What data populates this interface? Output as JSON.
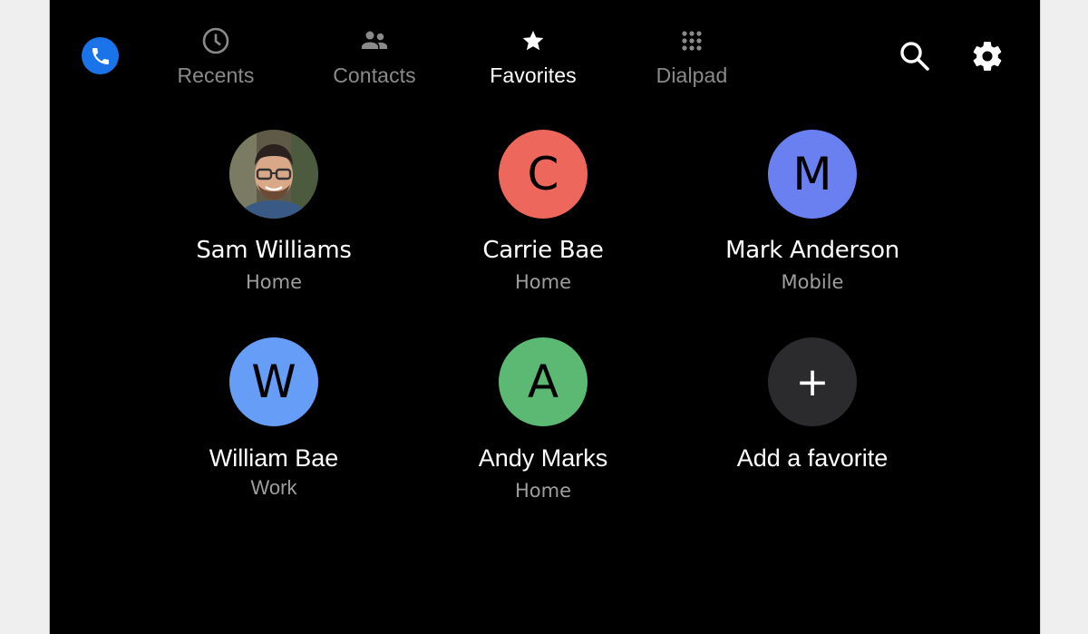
{
  "app": {
    "name": "Phone",
    "icon": "phone-icon",
    "accent_color": "#1a73e8"
  },
  "tabs": [
    {
      "label": "Recents",
      "icon": "clock-icon",
      "active": false
    },
    {
      "label": "Contacts",
      "icon": "people-icon",
      "active": false
    },
    {
      "label": "Favorites",
      "icon": "star-icon",
      "active": true
    },
    {
      "label": "Dialpad",
      "icon": "dialpad-icon",
      "active": false
    }
  ],
  "actions": {
    "search": {
      "icon": "search-icon",
      "label": "Search"
    },
    "settings": {
      "icon": "gear-icon",
      "label": "Settings"
    }
  },
  "favorites": [
    {
      "name": "Sam Williams",
      "type": "Home",
      "avatar": "photo",
      "initial": "",
      "color": ""
    },
    {
      "name": "Carrie Bae",
      "type": "Home",
      "avatar": "initial",
      "initial": "C",
      "color": "#ee675c"
    },
    {
      "name": "Mark Anderson",
      "type": "Mobile",
      "avatar": "initial",
      "initial": "M",
      "color": "#6a7ff0"
    },
    {
      "name": "William Bae",
      "type": "Work",
      "avatar": "initial",
      "initial": "W",
      "color": "#669df6"
    },
    {
      "name": "Andy Marks",
      "type": "Home",
      "avatar": "initial",
      "initial": "A",
      "color": "#5bb974"
    }
  ],
  "add_favorite": {
    "label": "Add a favorite",
    "icon": "plus-icon",
    "symbol": "+"
  }
}
